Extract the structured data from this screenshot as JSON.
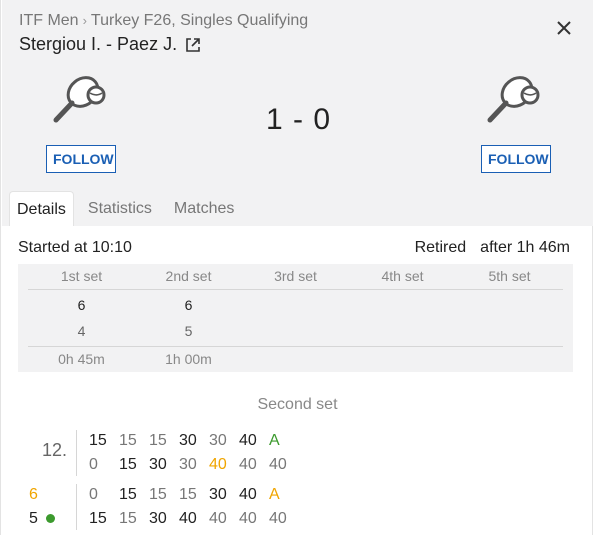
{
  "breadcrumb": {
    "category": "ITF Men",
    "tournament": "Turkey F26, Singles Qualifying"
  },
  "match": {
    "title": "Stergiou I. - Paez J.",
    "score": "1 - 0"
  },
  "follow_label": "FOLLOW",
  "tabs": [
    "Details",
    "Statistics",
    "Matches"
  ],
  "status": {
    "started": "Started at 10:10",
    "retired": "Retired",
    "duration": "after 1h 46m"
  },
  "sets_table": {
    "headers": [
      "1st set",
      "2nd set",
      "3rd set",
      "4th set",
      "5th set"
    ],
    "player1": [
      "6",
      "6",
      "",
      "",
      ""
    ],
    "player2": [
      "4",
      "5",
      "",
      "",
      ""
    ],
    "durations": [
      "0h 45m",
      "1h 00m",
      "",
      "",
      ""
    ]
  },
  "point_by_point": {
    "set_title": "Second set",
    "games": [
      {
        "label": "12.",
        "p1": [
          "15",
          "15",
          "15",
          "30",
          "30",
          "40",
          "A"
        ],
        "p2": [
          "0",
          "15",
          "30",
          "30",
          "40",
          "40",
          "40"
        ]
      },
      {
        "score_p1": "6",
        "score_p2": "5",
        "p1": [
          "0",
          "15",
          "15",
          "15",
          "30",
          "40",
          "A"
        ],
        "p2": [
          "15",
          "15",
          "30",
          "40",
          "40",
          "40",
          "40"
        ]
      }
    ]
  },
  "colors": {
    "accent": "#1a5fb4",
    "highlight": "#f0a500",
    "win": "#3c9a2e",
    "header_bg": "#f2f2f3"
  },
  "icons": [
    "external-link-icon",
    "close-icon",
    "tennis-racket-icon",
    "serve-dot-icon"
  ]
}
